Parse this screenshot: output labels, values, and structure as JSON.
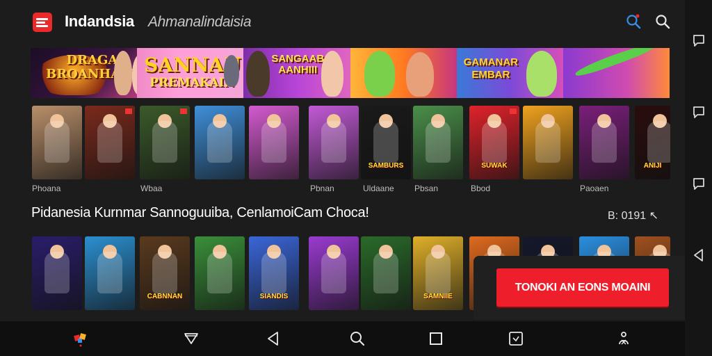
{
  "header": {
    "title": "Indandsia",
    "subtitle": "Ahmanalindaisia",
    "icons": [
      "search-red-dot-icon",
      "search-icon"
    ],
    "accent": "#e82a2a"
  },
  "side_rail": {
    "icons": [
      "chat-icon",
      "chat-icon",
      "chat-icon",
      "back-icon"
    ]
  },
  "banner": {
    "panels": [
      {
        "text": "DRAGA\nBROANHASS"
      },
      {
        "text": "SANNAU",
        "sub": "PREMAKAIN"
      },
      {
        "text": "SANGAAB\nAANHIII"
      },
      {
        "text": ""
      },
      {
        "text": "GAMANAR\nEMBAR"
      },
      {
        "text": ""
      }
    ]
  },
  "row1": {
    "tiles": [
      {
        "bg": "#b98f6a",
        "text": ""
      },
      {
        "bg": "#7a2a1c",
        "text": ""
      },
      {
        "bg": "#3b5a2a",
        "text": ""
      },
      {
        "bg": "#3f8fd8",
        "text": ""
      },
      {
        "bg": "#d45ad0",
        "text": ""
      },
      {
        "bg": "#c25ad6",
        "text": ""
      },
      {
        "bg": "#1a1a1a",
        "text": "SAMBURS"
      },
      {
        "bg": "#4b8f4a",
        "text": ""
      },
      {
        "bg": "#e0222b",
        "text": "SUWAK"
      },
      {
        "bg": "#f0a21e",
        "text": ""
      },
      {
        "bg": "#7a1f7a",
        "text": ""
      },
      {
        "bg": "#2a0d0d",
        "text": "ANIJI"
      }
    ],
    "labels": [
      "Phoana",
      "Wbaa",
      "Pbnan",
      "Uldaane",
      "Pbsan",
      "Bbod",
      "Paoaen"
    ]
  },
  "section": {
    "title": "Pidanesia Kurnmar Sannoguuiba, CenlamoiCam Choca!",
    "count": "B: 0191 ↖"
  },
  "row2": {
    "tiles": [
      {
        "bg": "#2a1d6a",
        "text": ""
      },
      {
        "bg": "#2b8fd0",
        "text": ""
      },
      {
        "bg": "#5a3a1e",
        "text": "CABNNAN"
      },
      {
        "bg": "#3a8f3a",
        "text": ""
      },
      {
        "bg": "#3a66d8",
        "text": "SIANDIS"
      },
      {
        "bg": "#9a3ad0",
        "text": ""
      },
      {
        "bg": "#2a6a2a",
        "text": ""
      },
      {
        "bg": "#e0b02a",
        "text": "SAMNIIE"
      },
      {
        "bg": "#e06a1e",
        "text": ""
      },
      {
        "bg": "#14182a",
        "text": ""
      },
      {
        "bg": "#2a8fe0",
        "text": ""
      },
      {
        "bg": "#a0501e",
        "text": ""
      }
    ]
  },
  "cta": {
    "label": "TONOKI AN EONS MOAINI",
    "color": "#ee1f2a"
  },
  "navbar": {
    "icons": [
      "app-logo-icon",
      "triangle-down-icon",
      "back-icon",
      "search-icon",
      "square-icon",
      "screenshot-icon",
      "accessibility-icon"
    ]
  }
}
